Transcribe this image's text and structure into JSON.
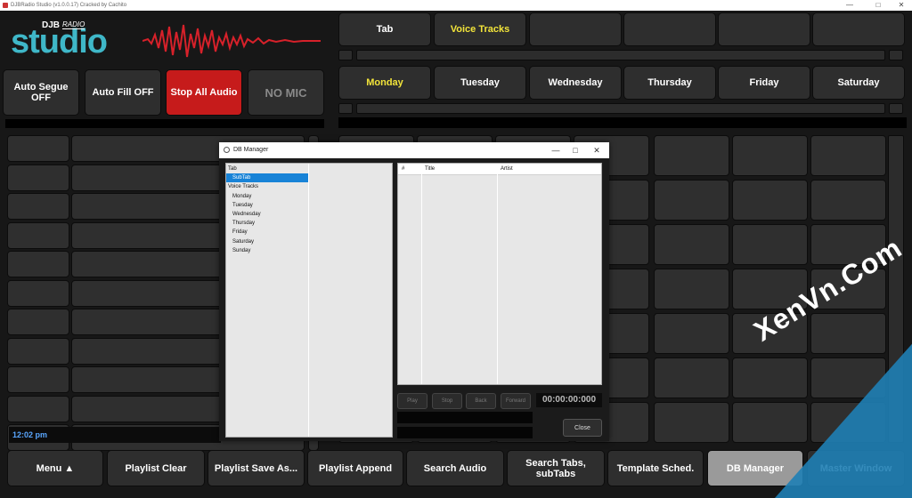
{
  "window": {
    "title": "DJBRadio Studio (v1.0.0.17) Cracked by Cachito",
    "controls": [
      "—",
      "□",
      "✕"
    ]
  },
  "logo": {
    "brand_small": "DJB",
    "brand_radio": "RADIO",
    "brand_big": "studio"
  },
  "controls": {
    "auto_segue": "Auto Segue OFF",
    "auto_fill": "Auto Fill OFF",
    "stop_all": "Stop All Audio",
    "mic": "NO MIC"
  },
  "tabs": [
    "Tab",
    "Voice Tracks"
  ],
  "days": [
    "Monday",
    "Tuesday",
    "Wednesday",
    "Thursday",
    "Friday",
    "Saturday"
  ],
  "clock": "12:02 pm",
  "bottom": [
    "Menu ▲",
    "Playlist Clear",
    "Playlist Save As...",
    "Playlist Append",
    "Search Audio",
    "Search Tabs, subTabs",
    "Template Sched.",
    "DB Manager",
    "Master Window"
  ],
  "dialog": {
    "title": "DB Manager",
    "controls": [
      "—",
      "□",
      "✕"
    ],
    "tree": [
      {
        "label": "Tab",
        "indent": 0,
        "selected": false
      },
      {
        "label": "SubTab",
        "indent": 1,
        "selected": true
      },
      {
        "label": "Voice Tracks",
        "indent": 0,
        "selected": false
      },
      {
        "label": "Monday",
        "indent": 1,
        "selected": false
      },
      {
        "label": "Tuesday",
        "indent": 1,
        "selected": false
      },
      {
        "label": "Wednesday",
        "indent": 1,
        "selected": false
      },
      {
        "label": "Thursday",
        "indent": 1,
        "selected": false
      },
      {
        "label": "Friday",
        "indent": 1,
        "selected": false
      },
      {
        "label": "Saturday",
        "indent": 1,
        "selected": false
      },
      {
        "label": "Sunday",
        "indent": 1,
        "selected": false
      }
    ],
    "columns": [
      "#",
      "Title",
      "Artist"
    ],
    "player": {
      "play": "Play",
      "stop": "Stop",
      "back": "Back",
      "forward": "Forward",
      "time": "00:00:00:000"
    },
    "close": "Close"
  },
  "watermark": "XenVn.Com",
  "colors": {
    "accent_yellow": "#f2e43a",
    "stop_red": "#c61b1b",
    "logo_teal": "#3fb7c8",
    "wave_red": "#d7212a",
    "selection_blue": "#1883d7",
    "active_gray": "#9a9a9a"
  }
}
